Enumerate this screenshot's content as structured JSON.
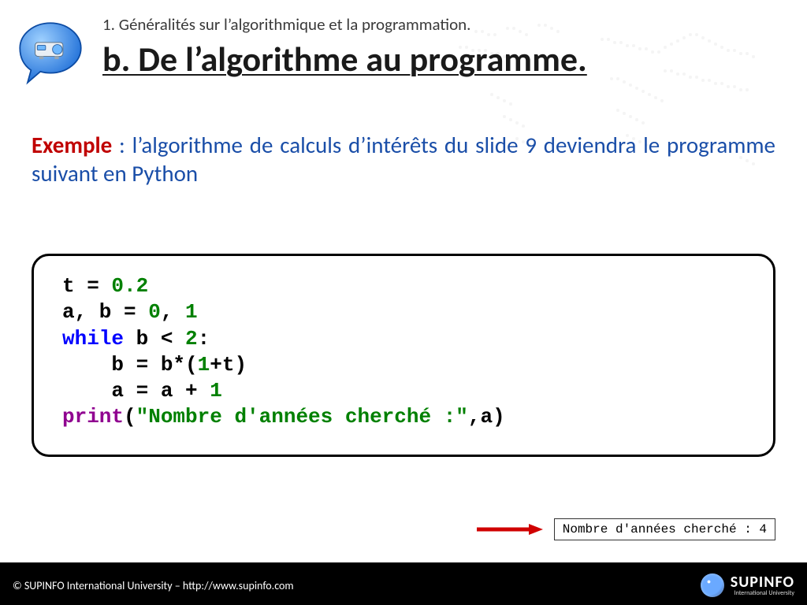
{
  "header": {
    "breadcrumb": "1. Généralités sur l’algorithmique et la programmation.",
    "title": "b. De l’algorithme au programme."
  },
  "body": {
    "accent": "Exemple",
    "rest": " : l’algorithme de calculs d’intérêts du slide 9 deviendra le programme suivant en Python"
  },
  "code": {
    "language": "python",
    "lines": [
      "t = 0.2",
      "a, b = 0, 1",
      "while b < 2:",
      "    b = b*(1+t)",
      "    a = a + 1",
      "print(\"Nombre d'années cherché :\",a)"
    ],
    "tokens": [
      [
        {
          "t": "t = ",
          "c": ""
        },
        {
          "t": "0.2",
          "c": "tk-num"
        }
      ],
      [
        {
          "t": "a, b = ",
          "c": ""
        },
        {
          "t": "0",
          "c": "tk-num"
        },
        {
          "t": ", ",
          "c": ""
        },
        {
          "t": "1",
          "c": "tk-num"
        }
      ],
      [
        {
          "t": "while",
          "c": "tk-kw"
        },
        {
          "t": " b < ",
          "c": ""
        },
        {
          "t": "2",
          "c": "tk-num"
        },
        {
          "t": ":",
          "c": ""
        }
      ],
      [
        {
          "t": "    b = b*(",
          "c": ""
        },
        {
          "t": "1",
          "c": "tk-num"
        },
        {
          "t": "+t)",
          "c": ""
        }
      ],
      [
        {
          "t": "    a = a + ",
          "c": ""
        },
        {
          "t": "1",
          "c": "tk-num"
        }
      ],
      [
        {
          "t": "print",
          "c": "tk-fn"
        },
        {
          "t": "(",
          "c": ""
        },
        {
          "t": "\"Nombre d'années cherché :\"",
          "c": "tk-str"
        },
        {
          "t": ",a)",
          "c": ""
        }
      ]
    ]
  },
  "output": {
    "text": "Nombre d'années cherché : 4"
  },
  "footer": {
    "copyright": "© SUPINFO International University – http://www.supinfo.com",
    "brand_line1": "SUPINFO",
    "brand_line2": "International University"
  },
  "icons": {
    "bubble": "speech-bubble-projector-icon",
    "arrow": "arrow-right-icon",
    "worldmap": "dotted-world-map"
  },
  "colors": {
    "accent_red": "#c00000",
    "body_blue": "#1a4ea8",
    "kw_blue": "#0000ff",
    "num_green": "#008000",
    "fn_purple": "#900090",
    "arrow_red": "#d00000"
  }
}
